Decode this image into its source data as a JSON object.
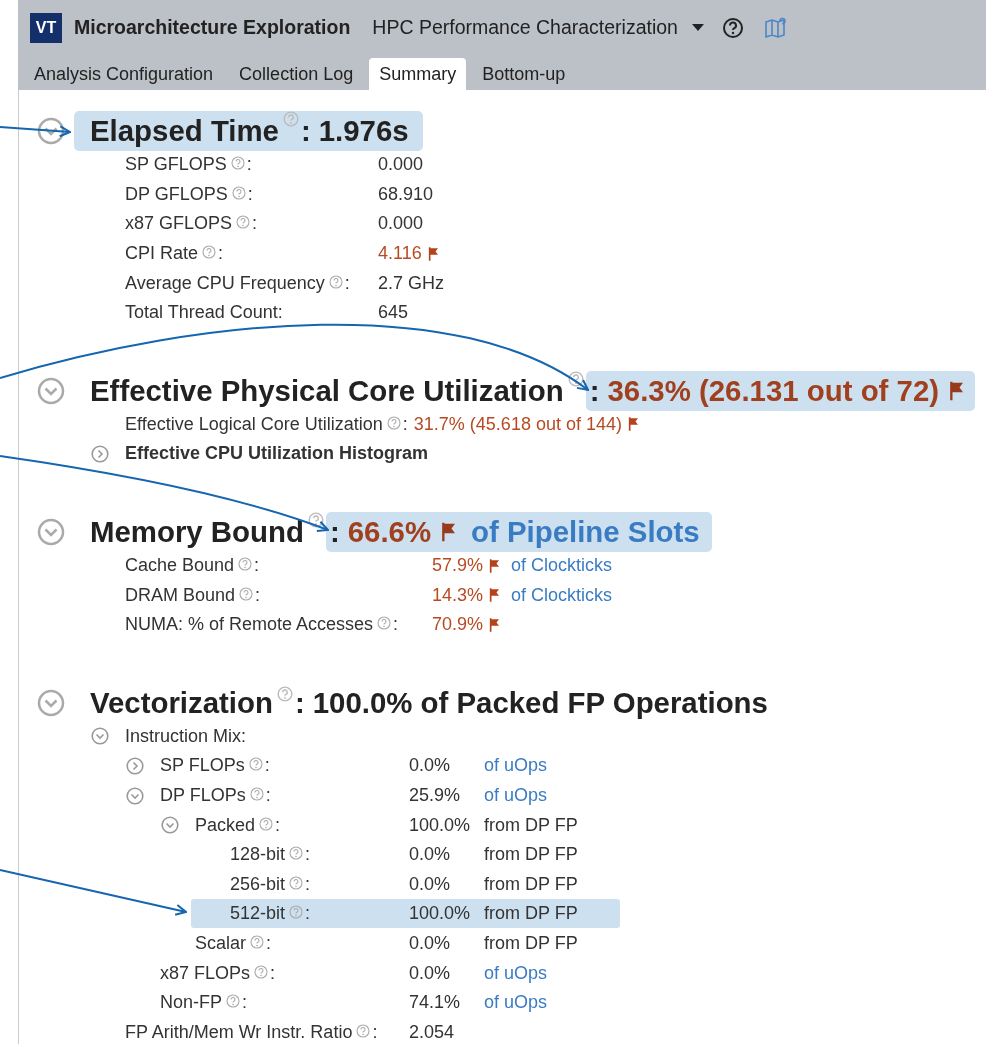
{
  "header": {
    "logo": "VT",
    "title": "Microarchitecture Exploration",
    "analysis": "HPC Performance Characterization"
  },
  "tabs": [
    {
      "label": "Analysis Configuration",
      "selected": false
    },
    {
      "label": "Collection Log",
      "selected": false
    },
    {
      "label": "Summary",
      "selected": true
    },
    {
      "label": "Bottom-up",
      "selected": false
    }
  ],
  "sections": [
    {
      "label": "Elapsed Time",
      "help": true,
      "sep": ":",
      "value": "1.976s",
      "flagged": false,
      "highlighted": true,
      "value_highlighted": false,
      "expanded": true,
      "rows": [
        {
          "kind": "metric",
          "label": "SP GFLOPS",
          "help": true,
          "sep": ":",
          "value": "0.000",
          "flagged": false,
          "highlighted": false
        },
        {
          "kind": "metric",
          "label": "DP GFLOPS",
          "help": true,
          "sep": ":",
          "value": "68.910",
          "flagged": false,
          "highlighted": false
        },
        {
          "kind": "metric",
          "label": "x87 GFLOPS",
          "help": true,
          "sep": ":",
          "value": "0.000",
          "flagged": false,
          "highlighted": false
        },
        {
          "kind": "metric",
          "label": "CPI Rate",
          "help": true,
          "sep": ":",
          "value": "4.116",
          "flagged": true,
          "highlighted": false
        },
        {
          "kind": "metric",
          "label": "Average CPU Frequency",
          "help": true,
          "sep": ":",
          "value": "2.7 GHz",
          "flagged": false,
          "highlighted": false
        },
        {
          "kind": "metric",
          "label": "Total Thread Count",
          "help": false,
          "sep": ":",
          "value": "645",
          "flagged": false,
          "highlighted": false
        }
      ]
    },
    {
      "label": "Effective Physical Core Utilization",
      "help": true,
      "sep": ":",
      "value": "36.3% (26.131 out of 72)",
      "flagged": true,
      "highlighted": false,
      "value_highlighted": true,
      "expanded": true,
      "rows": [
        {
          "kind": "metric",
          "label": "Effective Logical Core Utilization",
          "help": true,
          "sep": ":",
          "value": "31.7% (45.618 out of 144)",
          "flagged": true,
          "highlighted": false
        },
        {
          "kind": "subheading",
          "label": "Effective CPU Utilization Histogram",
          "help": false,
          "expanded": false,
          "highlighted": false
        }
      ]
    },
    {
      "label": "Memory Bound",
      "help": true,
      "sep": ":",
      "value": "66.6%",
      "flagged": true,
      "unit": "of Pipeline Slots",
      "highlighted": false,
      "value_highlighted": true,
      "expanded": true,
      "rows": [
        {
          "kind": "metric",
          "label": "Cache Bound",
          "help": true,
          "sep": ":",
          "value": "57.9%",
          "flagged": true,
          "unit": "of Clockticks",
          "unit_link": true,
          "highlighted": false
        },
        {
          "kind": "metric",
          "label": "DRAM Bound",
          "help": true,
          "sep": ":",
          "value": "14.3%",
          "flagged": true,
          "unit": "of Clockticks",
          "unit_link": true,
          "highlighted": false
        },
        {
          "kind": "metric",
          "label": "NUMA: % of Remote Accesses",
          "help": true,
          "sep": ":",
          "value": "70.9%",
          "flagged": true,
          "highlighted": false
        }
      ]
    },
    {
      "label": "Vectorization",
      "help": true,
      "sep": ":",
      "value": "100.0% of Packed FP Operations",
      "flagged": false,
      "highlighted": false,
      "value_highlighted": false,
      "expanded": true,
      "rows": [
        {
          "kind": "metric",
          "label": "Instruction Mix",
          "help": false,
          "sep": ":",
          "expanded": true,
          "highlighted": false,
          "children": [
            {
              "kind": "metric",
              "label": "SP FLOPs",
              "help": true,
              "sep": ":",
              "value": "0.0%",
              "flagged": false,
              "unit": "of uOps",
              "unit_link": true,
              "expanded": false,
              "highlighted": false
            },
            {
              "kind": "metric",
              "label": "DP FLOPs",
              "help": true,
              "sep": ":",
              "value": "25.9%",
              "flagged": false,
              "unit": "of uOps",
              "unit_link": true,
              "expanded": true,
              "highlighted": false,
              "children": [
                {
                  "kind": "metric",
                  "label": "Packed",
                  "help": true,
                  "sep": ":",
                  "value": "100.0%",
                  "flagged": false,
                  "unit": "from DP FP",
                  "unit_link": false,
                  "expanded": true,
                  "highlighted": false,
                  "children": [
                    {
                      "kind": "metric",
                      "label": "128-bit",
                      "help": true,
                      "sep": ":",
                      "value": "0.0%",
                      "flagged": false,
                      "unit": "from DP FP",
                      "unit_link": false,
                      "highlighted": false
                    },
                    {
                      "kind": "metric",
                      "label": "256-bit",
                      "help": true,
                      "sep": ":",
                      "value": "0.0%",
                      "flagged": false,
                      "unit": "from DP FP",
                      "unit_link": false,
                      "highlighted": false
                    },
                    {
                      "kind": "metric",
                      "label": "512-bit",
                      "help": true,
                      "sep": ":",
                      "value": "100.0%",
                      "flagged": false,
                      "unit": "from DP FP",
                      "unit_link": false,
                      "highlighted": true
                    }
                  ]
                },
                {
                  "kind": "metric",
                  "label": "Scalar",
                  "help": true,
                  "sep": ":",
                  "value": "0.0%",
                  "flagged": false,
                  "unit": "from DP FP",
                  "unit_link": false,
                  "highlighted": false
                }
              ]
            },
            {
              "kind": "metric",
              "label": "x87 FLOPs",
              "help": true,
              "sep": ":",
              "value": "0.0%",
              "flagged": false,
              "unit": "of uOps",
              "unit_link": true,
              "highlighted": false
            },
            {
              "kind": "metric",
              "label": "Non-FP",
              "help": true,
              "sep": ":",
              "value": "74.1%",
              "flagged": false,
              "unit": "of uOps",
              "unit_link": true,
              "highlighted": false
            }
          ]
        },
        {
          "kind": "metric",
          "label": "FP Arith/Mem Wr Instr. Ratio",
          "help": true,
          "sep": ":",
          "value": "2.054",
          "flagged": false,
          "highlighted": false
        }
      ]
    }
  ]
}
